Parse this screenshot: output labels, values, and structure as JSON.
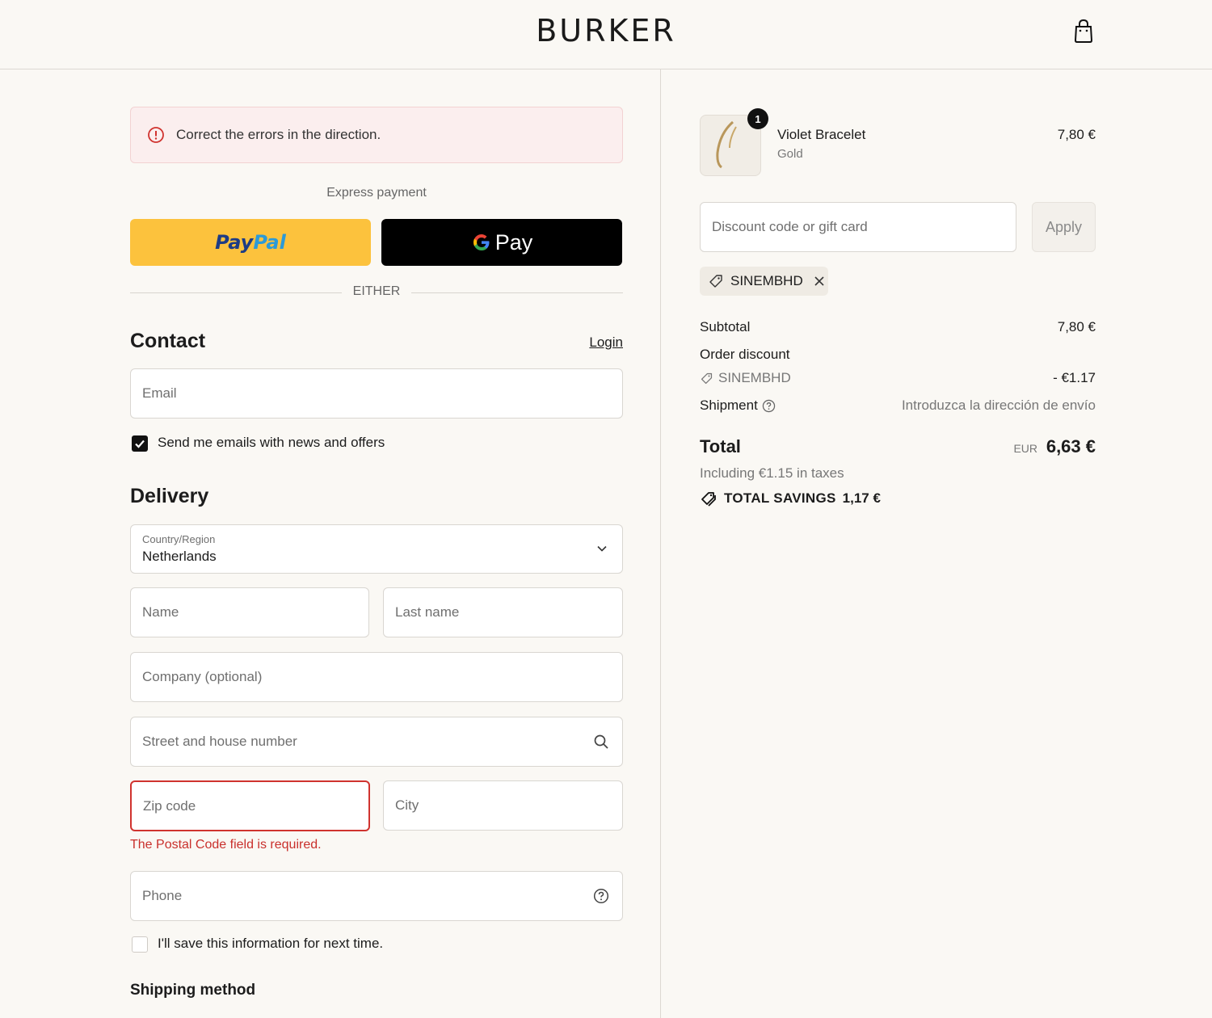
{
  "header": {
    "logo": "BURKER",
    "cart_icon": "shopping-bag-icon"
  },
  "error_banner": {
    "message": "Correct the errors in the direction.",
    "icon": "alert-circle-icon",
    "color": "#d0332f"
  },
  "express": {
    "label": "Express payment",
    "paypal": {
      "part1": "Pay",
      "part2": "Pal",
      "color": "#fcc23d"
    },
    "gpay": {
      "label": "Pay",
      "color": "#000000"
    },
    "separator": "EITHER"
  },
  "contact": {
    "title": "Contact",
    "login_label": "Login",
    "email_placeholder": "Email",
    "newsletter_label": "Send me emails with news and offers",
    "newsletter_checked": true
  },
  "delivery": {
    "title": "Delivery",
    "country_label": "Country/Region",
    "country_value": "Netherlands",
    "first_name_placeholder": "Name",
    "last_name_placeholder": "Last name",
    "company_placeholder": "Company (optional)",
    "street_placeholder": "Street and house number",
    "zip_placeholder": "Zip code",
    "city_placeholder": "City",
    "zip_error": "The Postal Code field is required.",
    "phone_placeholder": "Phone",
    "save_info_label": "I'll save this information for next time.",
    "save_info_checked": false
  },
  "shipping": {
    "title": "Shipping method"
  },
  "order": {
    "item": {
      "name": "Violet Bracelet",
      "variant": "Gold",
      "price": "7,80 €",
      "quantity": "1"
    },
    "discount_placeholder": "Discount code or gift card",
    "apply_label": "Apply",
    "applied_code": "SINEMBHD",
    "subtotal_label": "Subtotal",
    "subtotal_value": "7,80 €",
    "order_discount_label": "Order discount",
    "discount_code": "SINEMBHD",
    "discount_value": "- €1.17",
    "shipment_label": "Shipment",
    "shipment_value": "Introduzca la dirección de envío",
    "total_label": "Total",
    "currency": "EUR",
    "total_value": "6,63 €",
    "tax_note": "Including €1.15 in taxes",
    "savings_label": "TOTAL SAVINGS",
    "savings_value": "1,17 €"
  }
}
